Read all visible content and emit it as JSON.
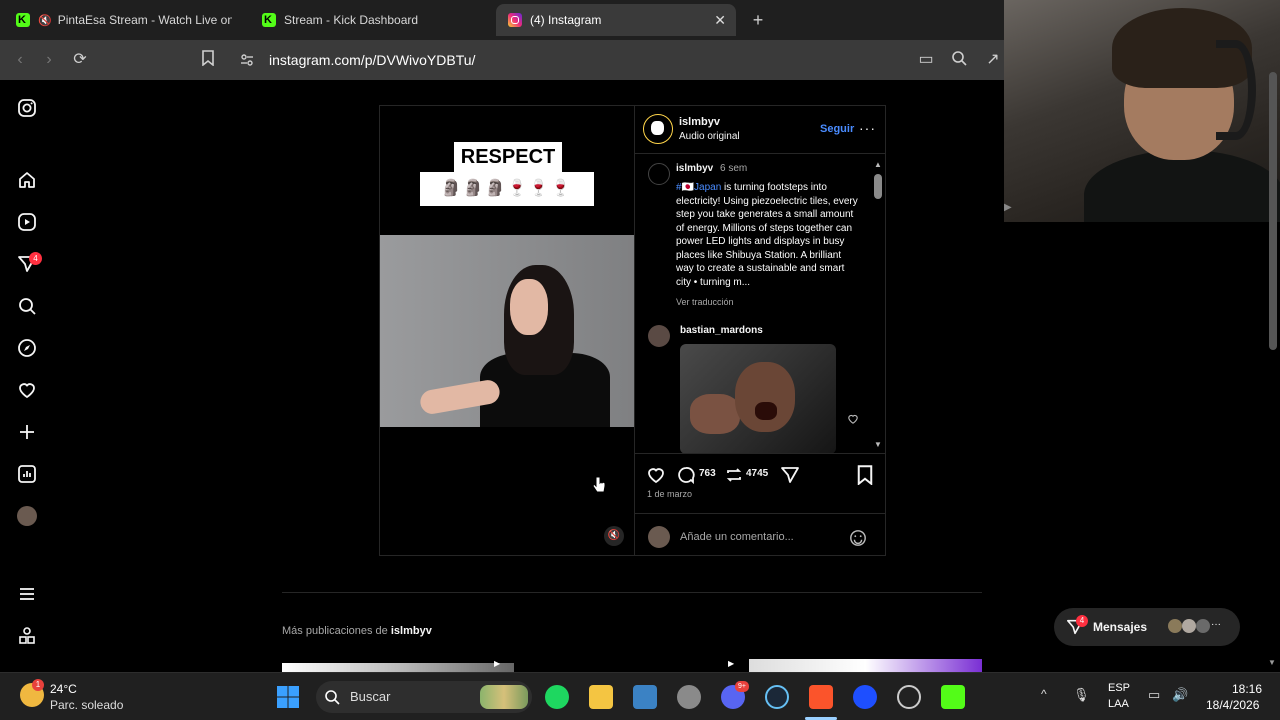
{
  "tabs": [
    {
      "label": "PintaEsa Stream - Watch Live on Kick",
      "muted": true
    },
    {
      "label": "Stream - Kick Dashboard"
    },
    {
      "label": "(4) Instagram",
      "active": true
    }
  ],
  "toolbar": {
    "url": "instagram.com/p/DVWivoYDBTu/"
  },
  "sidebar": {
    "notification_count": "4"
  },
  "post": {
    "media": {
      "respect_label": "RESPECT",
      "emoji_row": "🗿🗿🗿🍷🍷🍷"
    },
    "header": {
      "username": "islmbyv",
      "audio": "Audio original",
      "follow": "Seguir"
    },
    "caption": {
      "username": "islmbyv",
      "time": "6 sem",
      "hashtag": "#🇯🇵Japan",
      "text": " is turning footsteps into electricity! Using piezoelectric tiles, every step you take generates a small amount of energy. Millions of steps together can power LED lights and displays in busy places like Shibuya Station. A brilliant way to create a sustainable and smart city • turning m...",
      "translate": "Ver traducción"
    },
    "comment": {
      "username": "bastian_mardons"
    },
    "stats": {
      "comments": "763",
      "reposts": "4745",
      "date": "1 de marzo"
    },
    "comment_input": {
      "placeholder": "Añade un comentario..."
    }
  },
  "more_posts": {
    "prefix": "Más publicaciones de ",
    "username": "islmbyv"
  },
  "messages": {
    "label": "Mensajes",
    "badge": "4"
  },
  "taskbar": {
    "weather_temp": "24°C",
    "weather_desc": "Parc. soleado",
    "weather_badge": "1",
    "search": "Buscar",
    "discord_badge": "9+",
    "lang_top": "ESP",
    "lang_bottom": "LAA",
    "time": "18:16",
    "date": "18/4/2026"
  },
  "colors": {
    "accent_blue": "#4a8cff",
    "badge_red": "#ff3040",
    "kick_green": "#53fc18"
  }
}
